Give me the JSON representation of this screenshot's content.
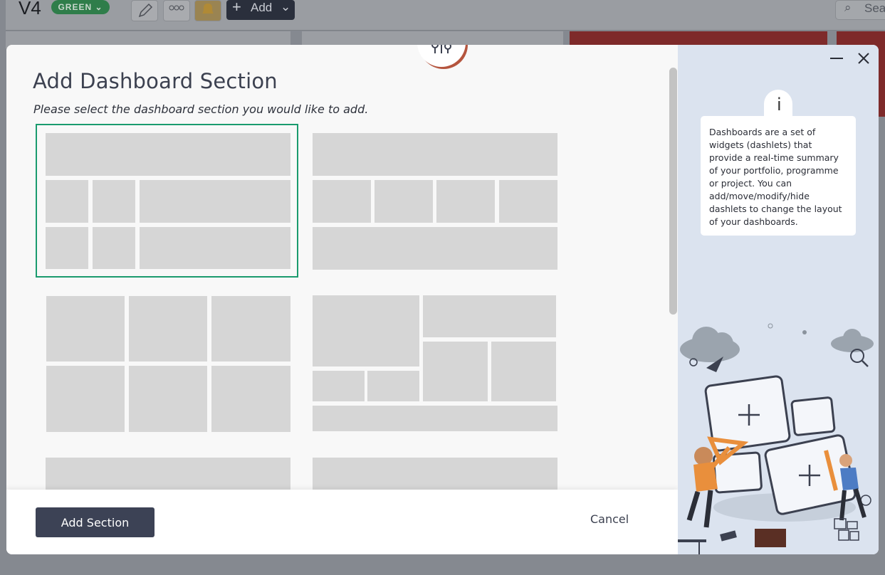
{
  "background": {
    "app_title": "V4",
    "status_badge": "GREEN",
    "add_label": "Add",
    "search_placeholder": "Sea"
  },
  "modal": {
    "title": "Add Dashboard Section",
    "subtitle": "Please select the dashboard section you would like to add.",
    "add_section_label": "Add Section",
    "cancel_label": "Cancel",
    "icon": "sliders-icon"
  },
  "side": {
    "info_icon_text": "i",
    "info_text": "Dashboards are a set of widgets (dashlets) that provide a real-time summary of your portfolio, programme or project. You can add/move/modify/hide dashlets to change the layout of your dashboards."
  },
  "colors": {
    "selected_outline": "#1a9b6e",
    "primary_button": "#3c4255",
    "placeholder_block": "#d6d6d6",
    "side_panel": "#dbe3ef"
  }
}
